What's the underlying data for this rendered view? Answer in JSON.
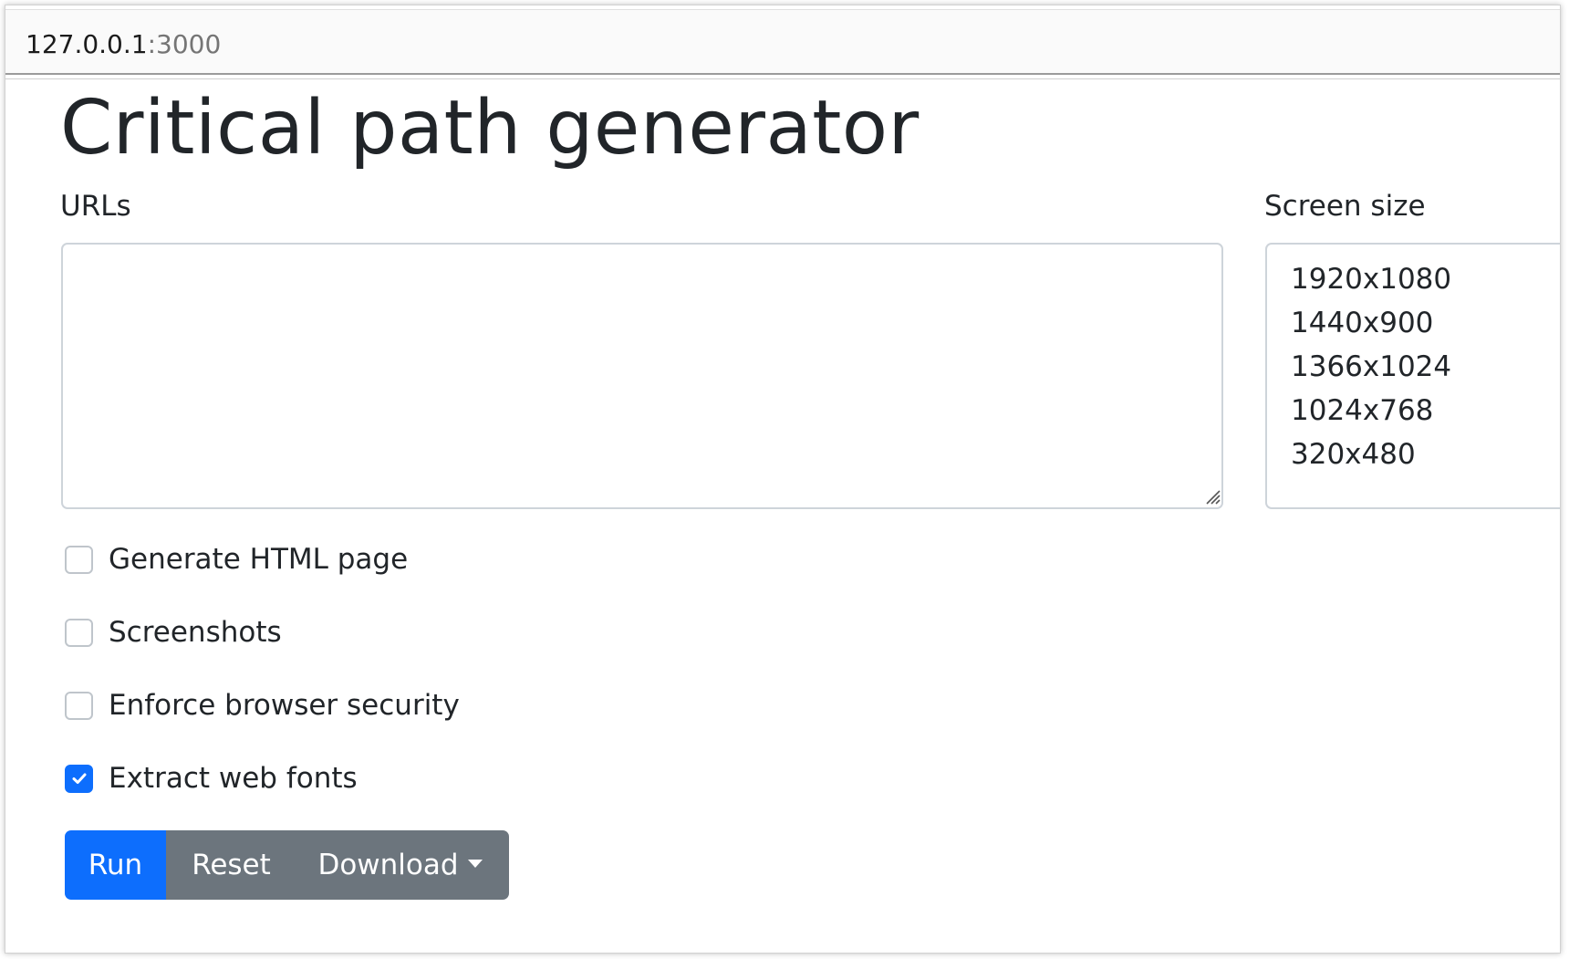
{
  "browser": {
    "url_host": "127.0.0.1",
    "url_port": ":3000"
  },
  "page": {
    "title": "Critical path generator"
  },
  "form": {
    "urls_label": "URLs",
    "urls_value": "",
    "screen_size_label": "Screen size",
    "screen_sizes": [
      "1920x1080",
      "1440x900",
      "1366x1024",
      "1024x768",
      "320x480"
    ],
    "options": [
      {
        "label": "Generate HTML page",
        "checked": false
      },
      {
        "label": "Screenshots",
        "checked": false
      },
      {
        "label": "Enforce browser security",
        "checked": false
      },
      {
        "label": "Extract web fonts",
        "checked": true
      }
    ],
    "buttons": {
      "run": "Run",
      "reset": "Reset",
      "download": "Download"
    }
  },
  "colors": {
    "primary": "#0d6efd",
    "secondary": "#6c757d",
    "text": "#212529",
    "border": "#ced4da"
  }
}
